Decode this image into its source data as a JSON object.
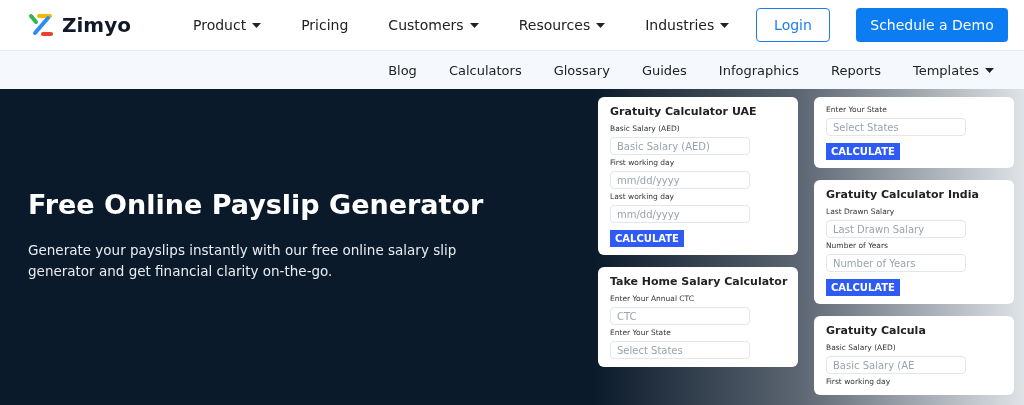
{
  "header": {
    "logo": "Zimyo",
    "nav": [
      {
        "label": "Product",
        "dropdown": true
      },
      {
        "label": "Pricing",
        "dropdown": false
      },
      {
        "label": "Customers",
        "dropdown": true
      },
      {
        "label": "Resources",
        "dropdown": true
      },
      {
        "label": "Industries",
        "dropdown": true
      }
    ],
    "login": "Login",
    "cta": "Schedule a Demo"
  },
  "subnav": [
    {
      "label": "Blog",
      "dropdown": false
    },
    {
      "label": "Calculators",
      "dropdown": false
    },
    {
      "label": "Glossary",
      "dropdown": false
    },
    {
      "label": "Guides",
      "dropdown": false
    },
    {
      "label": "Infographics",
      "dropdown": false
    },
    {
      "label": "Reports",
      "dropdown": false
    },
    {
      "label": "Templates",
      "dropdown": true
    }
  ],
  "hero": {
    "title": "Free Online Payslip Generator",
    "text": "Generate your payslips instantly with our free online salary slip generator and get financial clarity on-the-go."
  },
  "cards_left": [
    {
      "title": "Gratuity Calculator UAE",
      "fields": [
        {
          "label": "Basic Salary (AED)",
          "placeholder": "Basic Salary (AED)"
        },
        {
          "label": "First working day",
          "placeholder": "mm/dd/yyyy"
        },
        {
          "label": "Last working day",
          "placeholder": "mm/dd/yyyy"
        }
      ],
      "button": "CALCULATE"
    },
    {
      "title": "Take Home Salary Calculator",
      "fields": [
        {
          "label": "Enter Your Annual CTC",
          "placeholder": "CTC"
        },
        {
          "label": "Enter Your State",
          "placeholder": "Select States"
        }
      ]
    }
  ],
  "cards_right": [
    {
      "fields": [
        {
          "label": "Enter Your State",
          "placeholder": "Select States"
        }
      ],
      "button": "CALCULATE"
    },
    {
      "title": "Gratuity Calculator India",
      "fields": [
        {
          "label": "Last Drawn Salary",
          "placeholder": "Last Drawn Salary"
        },
        {
          "label": "Number of Years",
          "placeholder": "Number of Years"
        }
      ],
      "button": "CALCULATE"
    },
    {
      "title": "Gratuity Calcula",
      "fields": [
        {
          "label": "Basic Salary (AED)",
          "placeholder": "Basic Salary (AE"
        }
      ],
      "note": "First working day"
    }
  ]
}
